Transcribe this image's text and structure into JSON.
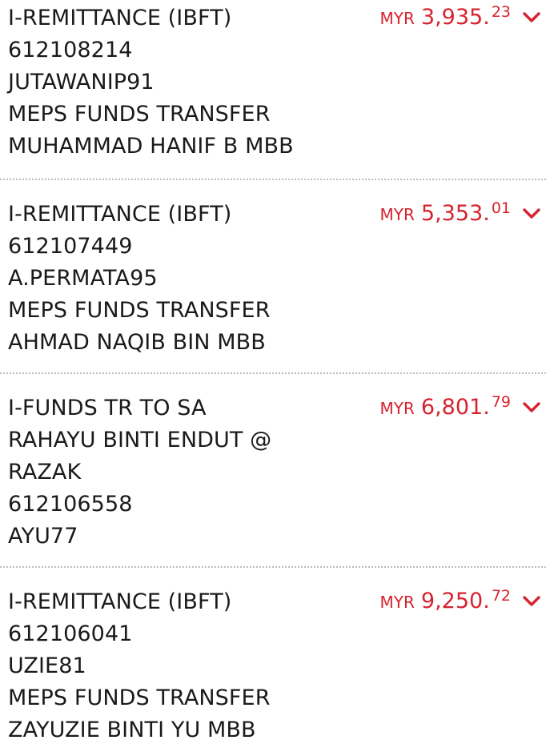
{
  "colors": {
    "accent": "#d6232f",
    "text": "#1a1a1a",
    "divider": "#bdbdbd"
  },
  "transactions": [
    {
      "lines": [
        "I-REMITTANCE (IBFT)",
        "612108214",
        "JUTAWANIP91",
        "MEPS FUNDS TRANSFER",
        "MUHAMMAD HANIF B MBB"
      ],
      "currency": "MYR",
      "amount_int": "3,935.",
      "amount_dec": "23",
      "expand_icon": "chevron-down-icon"
    },
    {
      "lines": [
        "I-REMITTANCE (IBFT)",
        "612107449",
        "A.PERMATA95",
        "MEPS FUNDS TRANSFER",
        "AHMAD NAQIB BIN MBB"
      ],
      "currency": "MYR",
      "amount_int": "5,353.",
      "amount_dec": "01",
      "expand_icon": "chevron-down-icon"
    },
    {
      "lines": [
        "I-FUNDS TR TO SA",
        "RAHAYU BINTI ENDUT @",
        "RAZAK",
        "612106558",
        "AYU77"
      ],
      "currency": "MYR",
      "amount_int": "6,801.",
      "amount_dec": "79",
      "expand_icon": "chevron-down-icon"
    },
    {
      "lines": [
        "I-REMITTANCE (IBFT)",
        "612106041",
        "UZIE81",
        "MEPS FUNDS TRANSFER",
        "ZAYUZIE BINTI YU MBB"
      ],
      "currency": "MYR",
      "amount_int": "9,250.",
      "amount_dec": "72",
      "expand_icon": "chevron-down-icon"
    }
  ]
}
